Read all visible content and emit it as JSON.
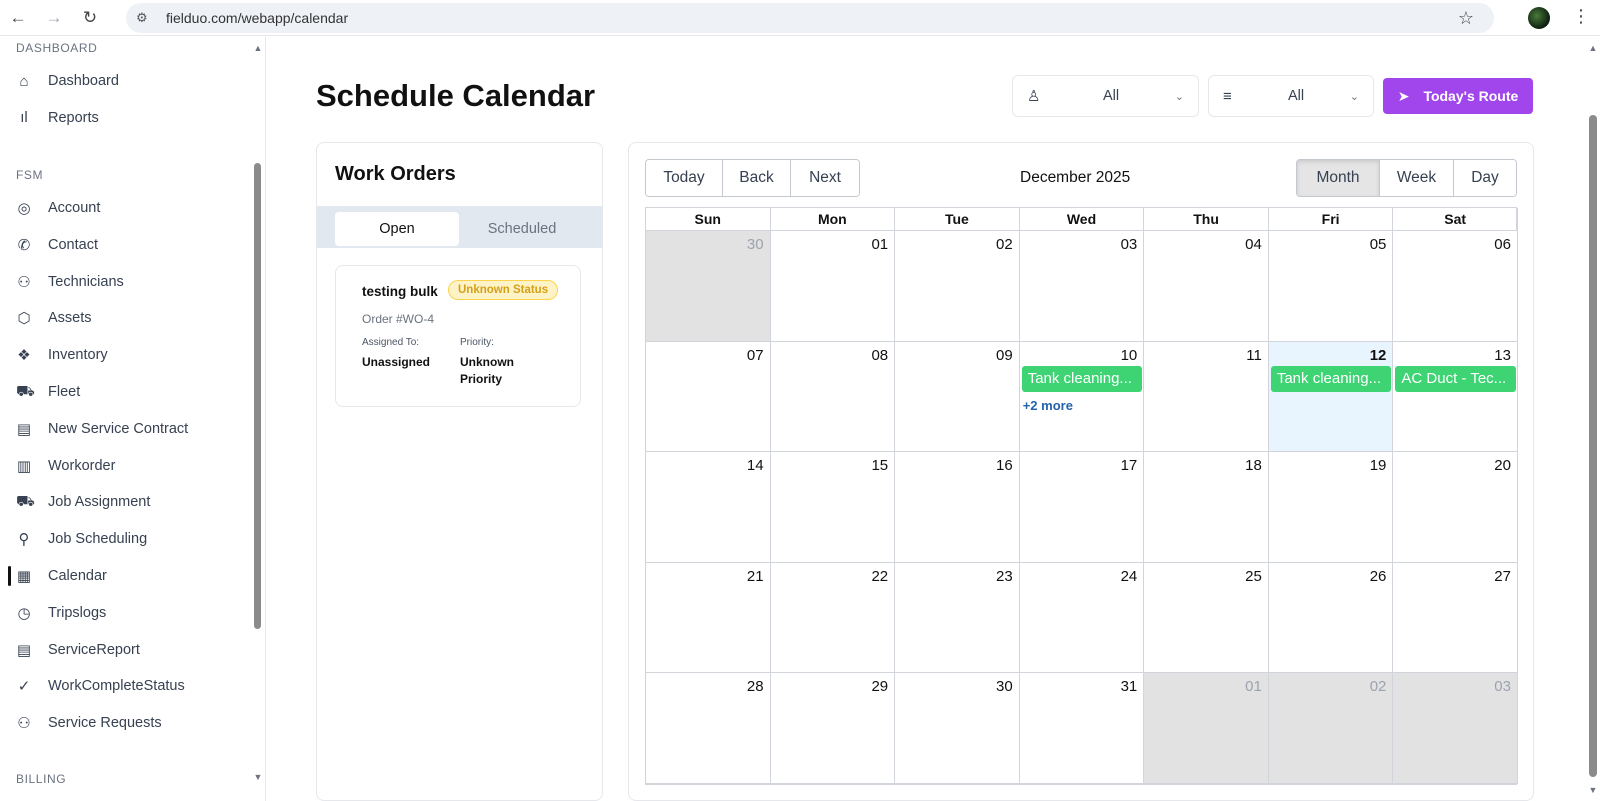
{
  "browser": {
    "url": "fielduo.com/webapp/calendar",
    "back_icon": "←",
    "forward_icon": "→",
    "reload_icon": "↻",
    "tune_icon": "⚙",
    "star_icon": "☆",
    "menu_icon": "⋮"
  },
  "sidebar": {
    "dashboard_header": "DASHBOARD",
    "fsm_header": "FSM",
    "billing_header": "BILLING",
    "dashboard_items": [
      {
        "label": "Dashboard",
        "icon": "⌂"
      },
      {
        "label": "Reports",
        "icon": "ıl"
      }
    ],
    "fsm_items": [
      {
        "label": "Account",
        "icon": "◎"
      },
      {
        "label": "Contact",
        "icon": "✆"
      },
      {
        "label": "Technicians",
        "icon": "⚇"
      },
      {
        "label": "Assets",
        "icon": "⬡"
      },
      {
        "label": "Inventory",
        "icon": "❖"
      },
      {
        "label": "Fleet",
        "icon": "⛟"
      },
      {
        "label": "New Service Contract",
        "icon": "▤"
      },
      {
        "label": "Workorder",
        "icon": "▥"
      },
      {
        "label": "Job Assignment",
        "icon": "⛟"
      },
      {
        "label": "Job Scheduling",
        "icon": "⚲"
      },
      {
        "label": "Calendar",
        "icon": "▦"
      },
      {
        "label": "Tripslogs",
        "icon": "◷"
      },
      {
        "label": "ServiceReport",
        "icon": "▤"
      },
      {
        "label": "WorkCompleteStatus",
        "icon": "✓"
      },
      {
        "label": "Service Requests",
        "icon": "⚇"
      }
    ],
    "active_item": "Calendar"
  },
  "header": {
    "title": "Schedule Calendar",
    "technician_filter": {
      "icon": "♙",
      "value": "All",
      "chevron": "⌄"
    },
    "status_filter": {
      "icon": "≡",
      "value": "All",
      "chevron": "⌄"
    },
    "route_button": {
      "icon": "➤",
      "label": "Today's Route"
    }
  },
  "work_orders": {
    "title": "Work Orders",
    "tabs": [
      "Open",
      "Scheduled"
    ],
    "active_tab": "Open",
    "items": [
      {
        "name": "testing bulk",
        "status": "Unknown Status",
        "order": "Order #WO-4",
        "assigned_label": "Assigned To:",
        "assigned_value": "Unassigned",
        "priority_label": "Priority:",
        "priority_value": "Unknown Priority"
      }
    ]
  },
  "calendar": {
    "nav_buttons": [
      "Today",
      "Back",
      "Next"
    ],
    "month_label": "December 2025",
    "view_buttons": [
      "Month",
      "Week",
      "Day"
    ],
    "active_view": "Month",
    "weekdays": [
      "Sun",
      "Mon",
      "Tue",
      "Wed",
      "Thu",
      "Fri",
      "Sat"
    ],
    "weeks": [
      [
        {
          "d": "30",
          "off": true
        },
        {
          "d": "01"
        },
        {
          "d": "02"
        },
        {
          "d": "03"
        },
        {
          "d": "04"
        },
        {
          "d": "05"
        },
        {
          "d": "06"
        }
      ],
      [
        {
          "d": "07"
        },
        {
          "d": "08"
        },
        {
          "d": "09"
        },
        {
          "d": "10",
          "events": [
            "Tank cleaning..."
          ],
          "more": "+2 more"
        },
        {
          "d": "11"
        },
        {
          "d": "12",
          "today": true,
          "events": [
            "Tank cleaning..."
          ]
        },
        {
          "d": "13",
          "events": [
            "AC Duct - Tec..."
          ]
        }
      ],
      [
        {
          "d": "14"
        },
        {
          "d": "15"
        },
        {
          "d": "16"
        },
        {
          "d": "17"
        },
        {
          "d": "18"
        },
        {
          "d": "19"
        },
        {
          "d": "20"
        }
      ],
      [
        {
          "d": "21"
        },
        {
          "d": "22"
        },
        {
          "d": "23"
        },
        {
          "d": "24"
        },
        {
          "d": "25"
        },
        {
          "d": "26"
        },
        {
          "d": "27"
        }
      ],
      [
        {
          "d": "28"
        },
        {
          "d": "29"
        },
        {
          "d": "30"
        },
        {
          "d": "31"
        },
        {
          "d": "01",
          "off": true
        },
        {
          "d": "02",
          "off": true
        },
        {
          "d": "03",
          "off": true
        }
      ]
    ]
  },
  "colors": {
    "accent": "#a146ec",
    "event": "#3ed474",
    "today": "#e8f4fe",
    "off_month": "#e2e2e2",
    "badge_text": "#d4a017"
  }
}
